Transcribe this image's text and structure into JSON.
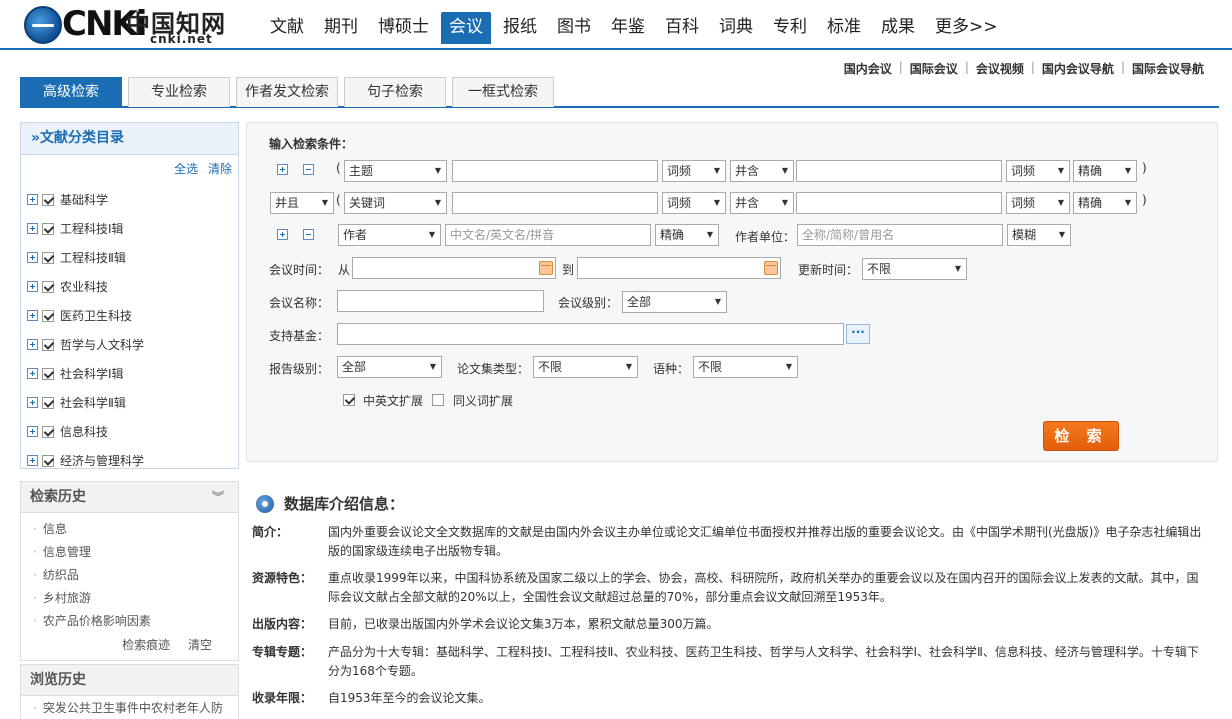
{
  "logo": {
    "word": "CNKi",
    "cn": "中国知网",
    "sub": "cnki.net"
  },
  "nav": [
    "文献",
    "期刊",
    "博硕士",
    "会议",
    "报纸",
    "图书",
    "年鉴",
    "百科",
    "词典",
    "专利",
    "标准",
    "成果",
    "更多>>"
  ],
  "nav_active": "会议",
  "sublinks": [
    "国内会议",
    "国际会议",
    "会议视频",
    "国内会议导航",
    "国际会议导航"
  ],
  "tabs": [
    "高级检索",
    "专业检索",
    "作者发文检索",
    "句子检索",
    "一框式检索"
  ],
  "category": {
    "title": "»文献分类目录",
    "select_all": "全选",
    "clear": "清除",
    "items": [
      "基础科学",
      "工程科技Ⅰ辑",
      "工程科技Ⅱ辑",
      "农业科技",
      "医药卫生科技",
      "哲学与人文科学",
      "社会科学Ⅰ辑",
      "社会科学Ⅱ辑",
      "信息科技",
      "经济与管理科学"
    ]
  },
  "history": {
    "title": "检索历史",
    "items": [
      "信息",
      "信息管理",
      "纺织品",
      "乡村旅游",
      "农产品价格影响因素"
    ],
    "trace": "检索痕迹",
    "clear": "清空"
  },
  "browse": {
    "title": "浏览历史",
    "items": [
      "突发公共卫生事件中农村老年人防"
    ]
  },
  "search": {
    "conditions_label": "输入检索条件：",
    "row1": {
      "field": "主题",
      "freq1": "词频",
      "op": "并含",
      "freq2": "词频",
      "match": "精确"
    },
    "row2": {
      "logic": "并且",
      "field": "关键词",
      "freq1": "词频",
      "op": "并含",
      "freq2": "词频",
      "match": "精确"
    },
    "row3": {
      "field": "作者",
      "author_placeholder": "中文名/英文名/拼音",
      "match": "精确",
      "unit_label": "作者单位：",
      "unit_placeholder": "全称/简称/曾用名",
      "unit_match": "模糊"
    },
    "time_label": "会议时间：",
    "from": "从",
    "to": "到",
    "update_label": "更新时间：",
    "update_value": "不限",
    "name_label": "会议名称：",
    "level_label": "会议级别：",
    "level_value": "全部",
    "fund_label": "支持基金：",
    "fund_btn": "···",
    "report_label": "报告级别：",
    "report_value": "全部",
    "type_label": "论文集类型：",
    "type_value": "不限",
    "lang_label": "语种：",
    "lang_value": "不限",
    "ext1": "中英文扩展",
    "ext2": "同义词扩展",
    "button": "检 索"
  },
  "info": {
    "title": "数据库介绍信息：",
    "rows": [
      {
        "k": "简介：",
        "v": "国内外重要会议论文全文数据库的文献是由国内外会议主办单位或论文汇编单位书面授权并推荐出版的重要会议论文。由《中国学术期刊(光盘版)》电子杂志社编辑出版的国家级连续电子出版物专辑。"
      },
      {
        "k": "资源特色：",
        "v": "重点收录1999年以来，中国科协系统及国家二级以上的学会、协会，高校、科研院所，政府机关举办的重要会议以及在国内召开的国际会议上发表的文献。其中，国际会议文献占全部文献的20%以上，全国性会议文献超过总量的70%，部分重点会议文献回溯至1953年。"
      },
      {
        "k": "出版内容：",
        "v": "目前，已收录出版国内外学术会议论文集3万本，累积文献总量300万篇。"
      },
      {
        "k": "专辑专题：",
        "v": "产品分为十大专辑：基础科学、工程科技Ⅰ、工程科技Ⅱ、农业科技、医药卫生科技、哲学与人文科学、社会科学Ⅰ、社会科学Ⅱ、信息科技、经济与管理科学。十专辑下分为168个专题。"
      },
      {
        "k": "收录年限：",
        "v": "自1953年至今的会议论文集。"
      }
    ]
  }
}
